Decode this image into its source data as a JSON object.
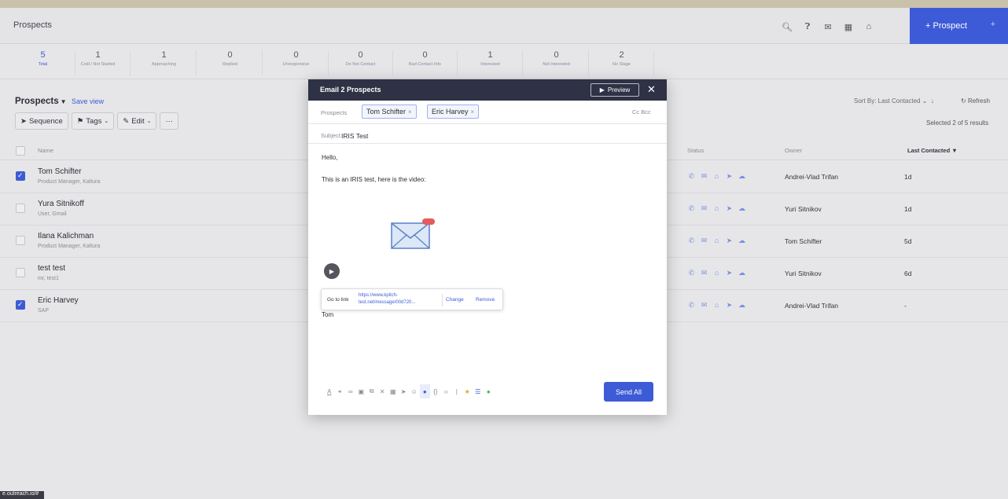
{
  "header": {
    "title": "Prospects",
    "icons": [
      "search-icon",
      "help-icon",
      "mail-icon",
      "calendar-icon",
      "bank-icon"
    ],
    "add_button": "+ Prospect",
    "add_button_extra": "+"
  },
  "stats": [
    {
      "count": "5",
      "label": "Total"
    },
    {
      "count": "1",
      "label": "Cold / Not Started"
    },
    {
      "count": "1",
      "label": "Approaching"
    },
    {
      "count": "0",
      "label": "Replied"
    },
    {
      "count": "0",
      "label": "Unresponsive"
    },
    {
      "count": "0",
      "label": "Do Not Contact"
    },
    {
      "count": "0",
      "label": "Bad Contact Info"
    },
    {
      "count": "1",
      "label": "Interested"
    },
    {
      "count": "0",
      "label": "Not Interested"
    },
    {
      "count": "2",
      "label": "No Stage"
    }
  ],
  "list": {
    "title": "Prospects",
    "save_view": "Save view",
    "toolbar": {
      "sequence": "Sequence",
      "tags": "Tags",
      "edit": "Edit",
      "more": "···"
    },
    "sort_by": "Sort By: Last Contacted",
    "refresh": "Refresh",
    "selected": "Selected 2 of 5 results"
  },
  "table": {
    "columns": {
      "name": "Name",
      "status": "Status",
      "owner": "Owner",
      "last_contacted": "Last Contacted"
    },
    "rows": [
      {
        "name": "Tom Schifter",
        "sub": "Product Manager, Kaltura",
        "owner": "Andrei-Vlad Trifan",
        "last": "1d",
        "checked": true
      },
      {
        "name": "Yura Sitnikoff",
        "sub": "User, Gmail",
        "owner": "Yuri Sitnikov",
        "last": "1d",
        "checked": false
      },
      {
        "name": "Ilana Kalichman",
        "sub": "Product Manager, Kaltura",
        "owner": "Tom Schifter",
        "last": "5d",
        "checked": false
      },
      {
        "name": "test test",
        "sub": "mr, test1",
        "owner": "Yuri Sitnikov",
        "last": "6d",
        "checked": false
      },
      {
        "name": "Eric Harvey",
        "sub": "SAP",
        "owner": "Andrei-Vlad Trifan",
        "last": "-",
        "checked": true
      }
    ]
  },
  "modal": {
    "title": "Email 2 Prospects",
    "preview": "Preview",
    "prospects_label": "Prospects",
    "chips": [
      "Tom Schifter",
      "Eric Harvey"
    ],
    "cc_bcc": "Cc Bcc",
    "subject_label": "Subject",
    "subject": "IRIS Test",
    "body": {
      "greeting": "Hello,",
      "line1": "This is an IRIS test, here is the video:",
      "signature": "Tom"
    },
    "link_popover": {
      "go_to": "Go to link",
      "url": "https://www.kpitch-test.net/message/00d720...",
      "change": "Change",
      "remove": "Remove"
    },
    "send_all": "Send All"
  },
  "status_bar_url": "e.outreach.io/#"
}
